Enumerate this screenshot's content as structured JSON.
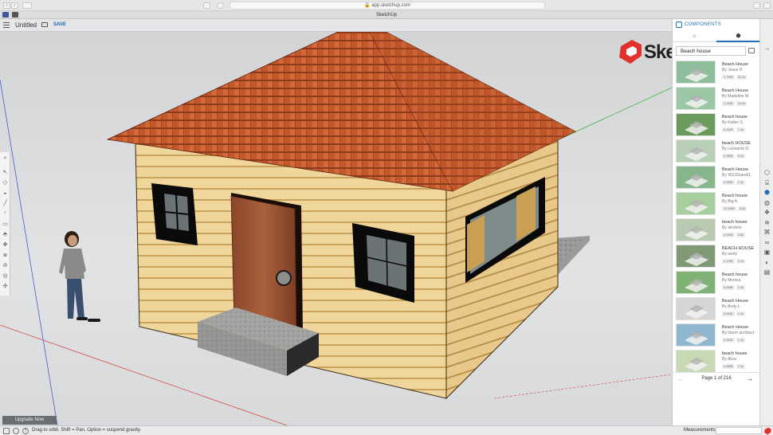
{
  "browser": {
    "url": "app.sketchup.com",
    "tab_title": "SketchUp"
  },
  "app": {
    "document_title": "Untitled",
    "save_label": "SAVE",
    "upgrade_label": "Upgrade Now",
    "logo_text": "Ske"
  },
  "toolbar": {
    "tools": [
      "search-tool",
      "select-tool",
      "eraser-tool",
      "paint-bucket-tool",
      "line-tool",
      "arc-tool",
      "rectangle-tool",
      "push-pull-tool",
      "move-tool",
      "offset-tool",
      "tape-measure-tool",
      "orbit-tool",
      "pan-tool",
      "walk-tool"
    ]
  },
  "status": {
    "hint_text": "Drag to orbit. Shift = Pan, Option = suspend gravity.",
    "measurements_label": "Measurements",
    "measurements_value": ""
  },
  "panel": {
    "title": "COMPONENTS",
    "search_value": "Beach house",
    "pager_text": "Page 1 of 216",
    "results": [
      {
        "name": "Beach House",
        "author": "By Jesus H.",
        "size": "1.7MB",
        "views": "45.1k",
        "thumb": "#8fbf9a"
      },
      {
        "name": "Beach House",
        "author": "By Madeline M.",
        "size": "3.2MB",
        "views": "18.2k",
        "thumb": "#9bc7a4"
      },
      {
        "name": "Beach house",
        "author": "By Kallen S.",
        "size": "8.4MB",
        "views": "7.4k",
        "thumb": "#6a9b5c"
      },
      {
        "name": "beach HOUSE",
        "author": "By Leonardo D.",
        "size": "0.3MB",
        "views": "8.2k",
        "thumb": "#b7cfb5"
      },
      {
        "name": "Beach House",
        "author": "By 95210xandi1",
        "size": "2.3MB",
        "views": "1.5k",
        "thumb": "#87b58c"
      },
      {
        "name": "Beach house",
        "author": "By Big A.",
        "size": "12.9MB",
        "views": "6.5k",
        "thumb": "#a6cf9d"
      },
      {
        "name": "beach house",
        "author": "By alexbrio",
        "size": "4.9MB",
        "views": "4.8k",
        "thumb": "#b8cab0"
      },
      {
        "name": "BEACH HOUSE",
        "author": "By werty",
        "size": "1.1MB",
        "views": "3.1k",
        "thumb": "#7f9a75"
      },
      {
        "name": "Beach house",
        "author": "By Monica",
        "size": "6.6MB",
        "views": "2.4k",
        "thumb": "#7fb274"
      },
      {
        "name": "Beach House",
        "author": "By Andy L.",
        "size": "5.5MB",
        "views": "1.4k",
        "thumb": "#d4d6d4"
      },
      {
        "name": "Beach House",
        "author": "By future architect",
        "size": "0.5MB",
        "views": "1.4k",
        "thumb": "#8fb7cf"
      },
      {
        "name": "beach house",
        "author": "By Aliza",
        "size": "0.8MB",
        "views": "2.1k",
        "thumb": "#c7d8b5"
      }
    ]
  },
  "rail": {
    "icons": [
      "entity-info-icon",
      "instructor-icon",
      "components-icon",
      "materials-icon",
      "styles-icon",
      "layers-icon",
      "outliner-icon",
      "scenes-icon",
      "display-icon",
      "shadows-icon",
      "solid-inspector-icon"
    ]
  },
  "colors": {
    "accent": "#1e6fb8",
    "roof": "#c2562a",
    "siding": "#f0d49a",
    "door": "#9a5233",
    "logo_red": "#e0322b"
  }
}
